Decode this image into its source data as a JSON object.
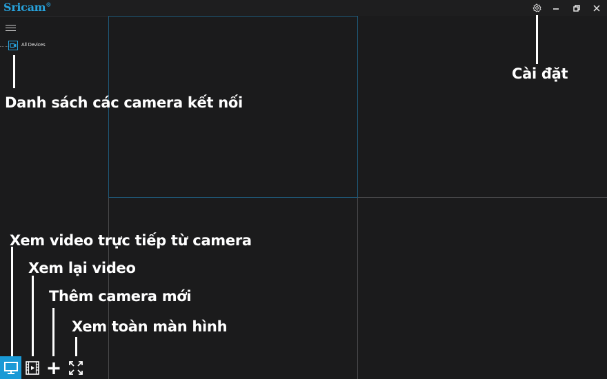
{
  "app": {
    "logo_text": "Sricam",
    "logo_mark": "®"
  },
  "window_controls": {
    "settings_icon": "gear-icon",
    "minimize_icon": "minimize-icon",
    "restore_icon": "restore-icon",
    "close_icon": "close-icon"
  },
  "sidebar": {
    "menu_icon": "hamburger-icon",
    "tree": [
      {
        "label": "All Devices",
        "icon": "camera-icon"
      }
    ]
  },
  "video_grid": {
    "layout": "2x2",
    "selected_cell": 1
  },
  "toolbar": {
    "buttons": [
      {
        "icon": "monitor-icon",
        "active": true
      },
      {
        "icon": "film-icon",
        "active": false
      },
      {
        "icon": "plus-icon",
        "active": false
      },
      {
        "icon": "fullscreen-icon",
        "active": false
      }
    ]
  },
  "annotations": {
    "settings": "Cài đặt",
    "camera_list": "Danh sách các camera kết nối",
    "live_view": "Xem video trực tiếp từ camera",
    "playback": "Xem lại video",
    "add_camera": "Thêm camera mới",
    "fullscreen": "Xem toàn màn hình"
  },
  "colors": {
    "accent": "#1a9ad6",
    "background": "#1b1b1c",
    "logo": "#27a2dc"
  }
}
